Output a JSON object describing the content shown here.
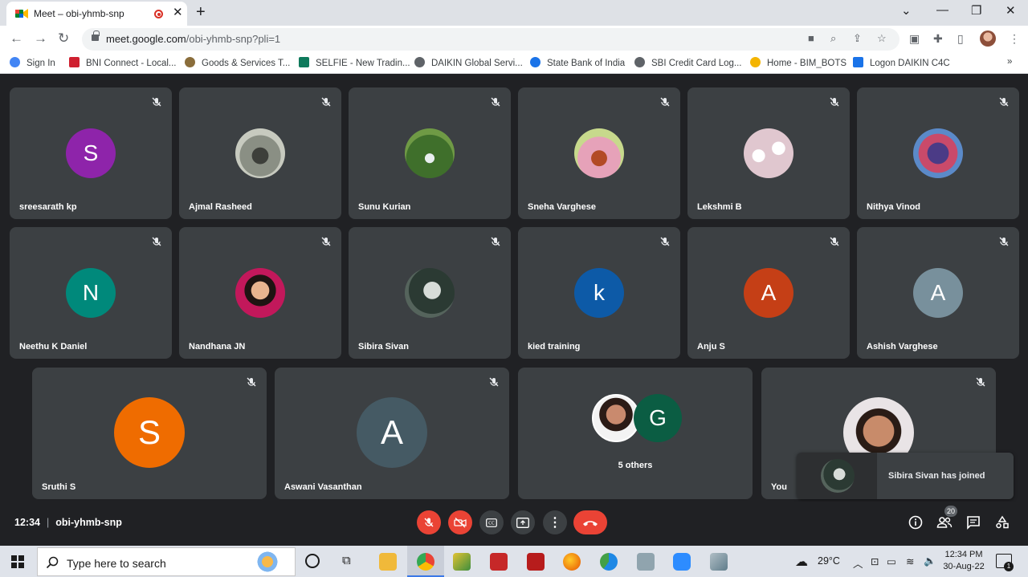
{
  "browser": {
    "tab_title": "Meet – obi-yhmb-snp",
    "url_host": "meet.google.com",
    "url_path": "/obi-yhmb-snp?pli=1",
    "bookmarks": [
      {
        "label": "Sign In",
        "icon": "google-icon",
        "color": "#4285f4"
      },
      {
        "label": "BNI Connect - Local...",
        "icon": "bni-icon",
        "color": "#cf2030"
      },
      {
        "label": "Goods & Services T...",
        "icon": "emblem-icon",
        "color": "#8a6d3b"
      },
      {
        "label": "SELFIE - New Tradin...",
        "icon": "selfie-icon",
        "color": "#0f7a5c"
      },
      {
        "label": "DAIKIN Global Servi...",
        "icon": "globe-icon",
        "color": "#5f6368"
      },
      {
        "label": "State Bank of India",
        "icon": "sbi-icon",
        "color": "#1a73e8"
      },
      {
        "label": "SBI Credit Card Log...",
        "icon": "globe-icon",
        "color": "#5f6368"
      },
      {
        "label": "Home - BIM_BOTS",
        "icon": "bim-icon",
        "color": "#f4b400"
      },
      {
        "label": "Logon DAIKIN C4C",
        "icon": "sap-icon",
        "color": "#1a73e8"
      }
    ]
  },
  "meet": {
    "tiles": [
      {
        "name": "sreesarath kp",
        "initial": "S",
        "color": "#8e24aa"
      },
      {
        "name": "Ajmal Rasheed",
        "initial": "",
        "color": "#6d7a6a"
      },
      {
        "name": "Sunu Kurian",
        "initial": "",
        "color": "#4f7a3a"
      },
      {
        "name": "Sneha Varghese",
        "initial": "",
        "color": "#d98aa5"
      },
      {
        "name": "Lekshmi B",
        "initial": "",
        "color": "#e7d3d8"
      },
      {
        "name": "Nithya Vinod",
        "initial": "",
        "color": "#7b5ea8"
      },
      {
        "name": "Neethu K Daniel",
        "initial": "N",
        "color": "#00897b"
      },
      {
        "name": "Nandhana JN",
        "initial": "",
        "color": "#c2185b"
      },
      {
        "name": "Sibira Sivan",
        "initial": "",
        "color": "#34453d"
      },
      {
        "name": "kied training",
        "initial": "k",
        "color": "#0d5aa7"
      },
      {
        "name": "Anju S",
        "initial": "A",
        "color": "#c53f16"
      },
      {
        "name": "Ashish Varghese",
        "initial": "A",
        "color": "#78909c"
      },
      {
        "name": "Sruthi S",
        "initial": "S",
        "color": "#ef6c00"
      },
      {
        "name": "Aswani Vasanthan",
        "initial": "A",
        "color": "#455a64"
      }
    ],
    "others": {
      "label": "5 others",
      "initial": "G",
      "color": "#0b5d43"
    },
    "you": {
      "name": "You"
    },
    "toast": "Sibira Sivan has joined",
    "time": "12:34",
    "meeting_code": "obi-yhmb-snp",
    "participant_count": "20"
  },
  "taskbar": {
    "search_placeholder": "Type here to search",
    "weather": "29°C",
    "time": "12:34 PM",
    "date": "30-Aug-22",
    "notification_count": "1"
  }
}
